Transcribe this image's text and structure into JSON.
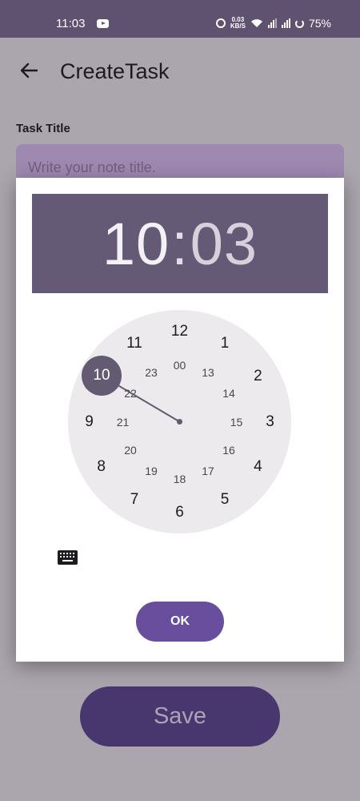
{
  "status_bar": {
    "time": "11:03",
    "net_speed_value": "0.03",
    "net_speed_unit": "KB/S",
    "battery": "75%",
    "icons": [
      "youtube-icon",
      "alarm-icon",
      "wifi-icon",
      "signal-icon",
      "signal-icon",
      "battery-icon"
    ]
  },
  "header": {
    "title": "CreateTask",
    "back_icon": "back-arrow-icon"
  },
  "form": {
    "task_title_label": "Task Title",
    "task_title_placeholder": "Write your note title."
  },
  "time_picker": {
    "hour": "10",
    "colon": ":",
    "minute": "03",
    "selected_hour": "10",
    "outer_numbers": [
      "12",
      "1",
      "2",
      "3",
      "4",
      "5",
      "6",
      "7",
      "8",
      "9",
      "10",
      "11"
    ],
    "inner_numbers": [
      "00",
      "13",
      "14",
      "15",
      "16",
      "17",
      "18",
      "19",
      "20",
      "21",
      "22",
      "23"
    ],
    "keyboard_icon": "keyboard-icon",
    "ok_label": "OK"
  },
  "save_label": "Save",
  "colors": {
    "status_bar": "#5f5170",
    "scrim_background": "#aba5ad",
    "time_header": "#645a76",
    "clock_face": "#eceaed",
    "selection": "#625b71",
    "ok_button": "#6a4e9e",
    "save_button": "#48366e"
  }
}
